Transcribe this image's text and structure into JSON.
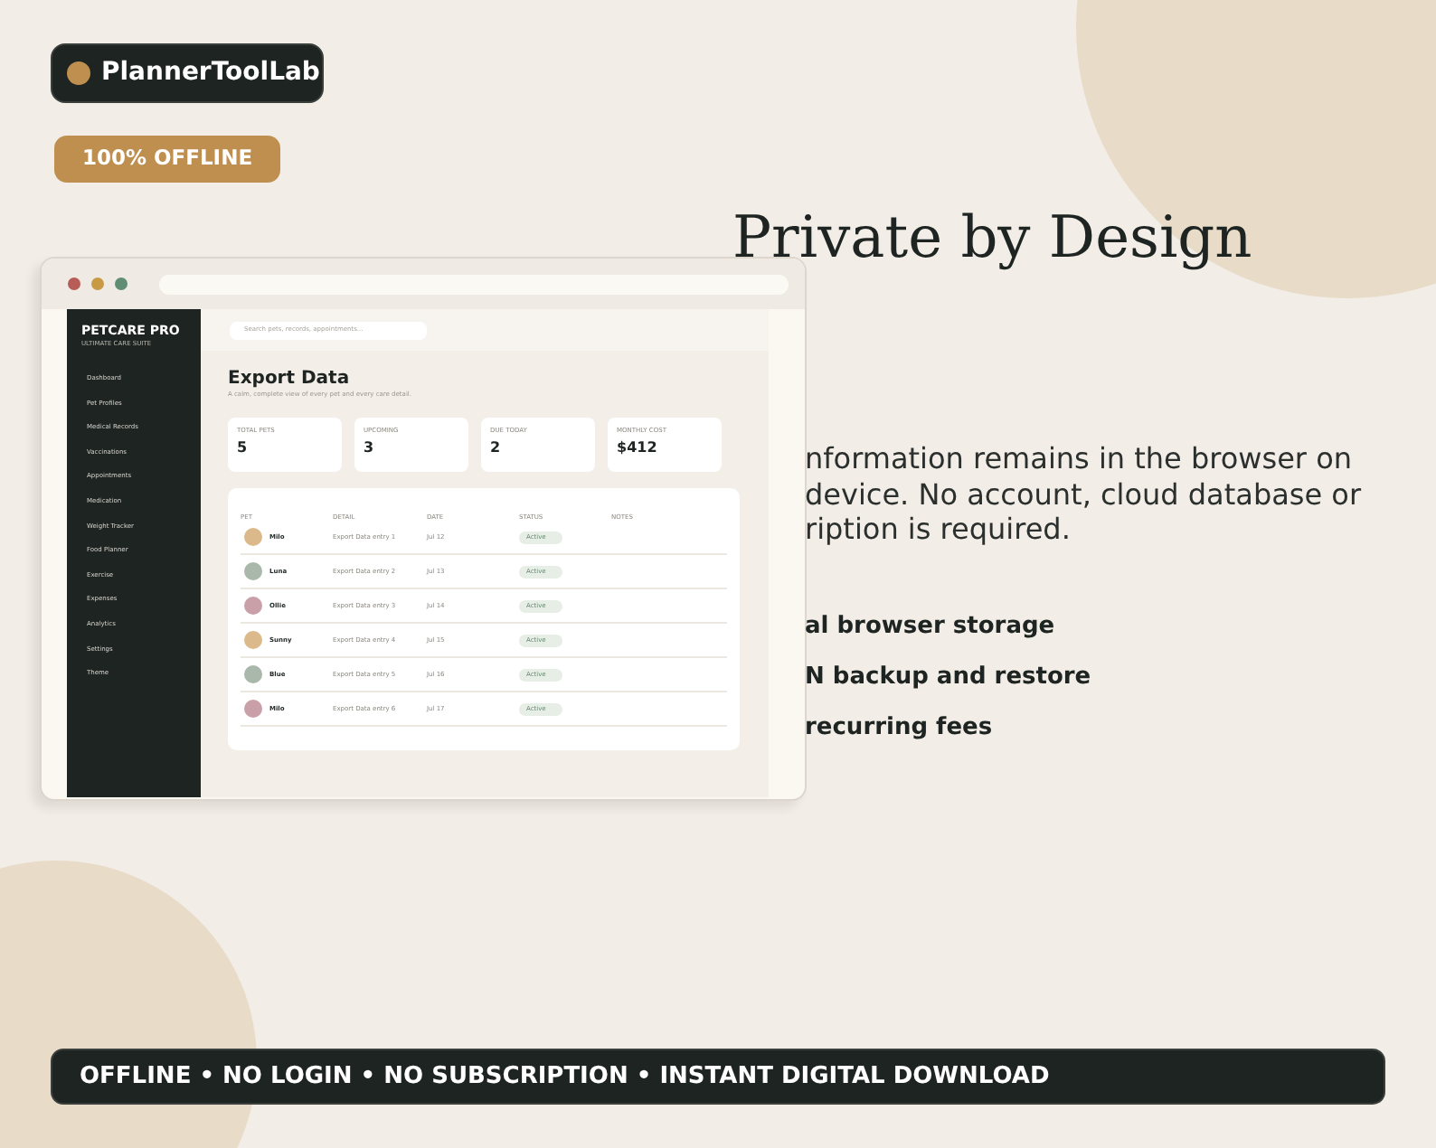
{
  "brand": {
    "name": "PlannerToolLab"
  },
  "badge": "100% OFFLINE",
  "mockup": {
    "app_name": "PETCARE PRO",
    "app_subtitle": "ULTIMATE CARE SUITE",
    "sidebar": [
      "Dashboard",
      "Pet Profiles",
      "Medical Records",
      "Vaccinations",
      "Appointments",
      "Medication",
      "Weight Tracker",
      "Food Planner",
      "Exercise",
      "Expenses",
      "Analytics",
      "Settings",
      "Theme"
    ],
    "search": {
      "placeholder": "Search pets, records, appointments..."
    },
    "title": "Export Data",
    "subtitle": "A calm, complete view of every pet and every care detail.",
    "stats": [
      {
        "label": "TOTAL PETS",
        "value": "5"
      },
      {
        "label": "UPCOMING",
        "value": "3"
      },
      {
        "label": "DUE TODAY",
        "value": "2"
      },
      {
        "label": "MONTHLY COST",
        "value": "$412"
      }
    ],
    "table": {
      "columns": [
        "PET",
        "DETAIL",
        "DATE",
        "STATUS",
        "NOTES"
      ],
      "rows": [
        {
          "pet": "Milo",
          "color": "#dcb98a",
          "detail": "Export Data entry 1",
          "date": "Jul 12",
          "status": "Active"
        },
        {
          "pet": "Luna",
          "color": "#a9b8aa",
          "detail": "Export Data entry 2",
          "date": "Jul 13",
          "status": "Active"
        },
        {
          "pet": "Ollie",
          "color": "#caa0a8",
          "detail": "Export Data entry 3",
          "date": "Jul 14",
          "status": "Active"
        },
        {
          "pet": "Sunny",
          "color": "#dcb98a",
          "detail": "Export Data entry 4",
          "date": "Jul 15",
          "status": "Active"
        },
        {
          "pet": "Blue",
          "color": "#a9b8aa",
          "detail": "Export Data entry 5",
          "date": "Jul 16",
          "status": "Active"
        },
        {
          "pet": "Milo",
          "color": "#caa0a8",
          "detail": "Export Data entry 6",
          "date": "Jul 17",
          "status": "Active"
        }
      ]
    }
  },
  "headline": "Private by Design",
  "paragraph_lines": [
    "nformation remains in the browser on",
    "device. No account, cloud database or",
    "ription is required."
  ],
  "features": [
    "al browser storage",
    "N backup and restore",
    "recurring fees"
  ],
  "footer": "OFFLINE • NO LOGIN • NO SUBSCRIPTION • INSTANT DIGITAL DOWNLOAD"
}
